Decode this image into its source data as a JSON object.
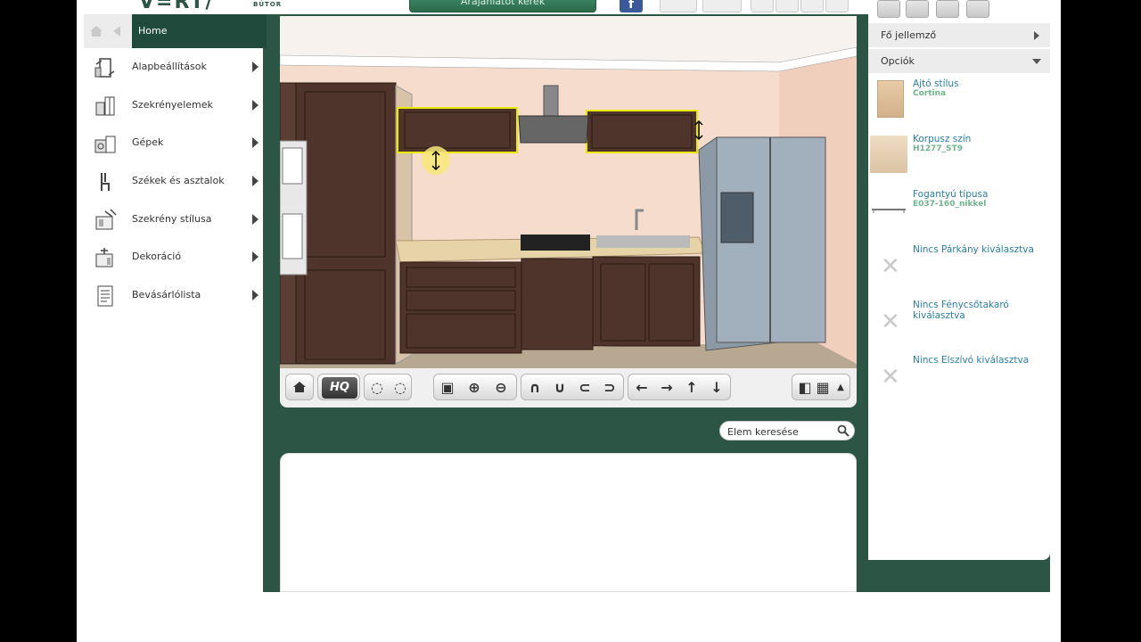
{
  "header": {
    "logo_text": "V=RT/",
    "logo_sub": "BÚTOR",
    "quote_button": "Árajánlatot kérek"
  },
  "sidebar": {
    "home_label": "Home",
    "items": [
      {
        "label": "Alapbeállítások",
        "icon": "settings-cabinet-icon"
      },
      {
        "label": "Szekrényelemek",
        "icon": "cabinet-elements-icon"
      },
      {
        "label": "Gépek",
        "icon": "appliances-icon"
      },
      {
        "label": "Székek és asztalok",
        "icon": "chair-table-icon"
      },
      {
        "label": "Szekrény stílusa",
        "icon": "cabinet-style-icon"
      },
      {
        "label": "Dekoráció",
        "icon": "decoration-icon"
      },
      {
        "label": "Bevásárlólista",
        "icon": "shopping-list-icon"
      }
    ]
  },
  "toolbar3d": {
    "hq_label": "HQ"
  },
  "search": {
    "placeholder": "Elem keresése"
  },
  "rightpanel": {
    "accordion": [
      {
        "label": "Fő jellemző",
        "expanded": false
      },
      {
        "label": "Opciók",
        "expanded": true
      }
    ],
    "options": [
      {
        "title": "Ajtó stílus",
        "value": "Cortina",
        "thumb": "door-style-thumb"
      },
      {
        "title": "Korpusz szín",
        "value": "H1277_ST9",
        "thumb": "body-color-thumb"
      },
      {
        "title": "Fogantyú típusa",
        "value": "E037-160_nikkel",
        "thumb": "handle-thumb"
      },
      {
        "title": "Nincs Párkány kiválasztva",
        "value": "",
        "thumb": "none-x-icon"
      },
      {
        "title": "Nincs Fénycsőtakaró kiválasztva",
        "value": "",
        "thumb": "none-x-icon"
      },
      {
        "title": "Nincs Elszívó kiválasztva",
        "value": "",
        "thumb": "none-x-icon"
      }
    ]
  },
  "colors": {
    "brand_green": "#2c5546",
    "link_blue": "#2a7fa0",
    "sub_green": "#6fb58c"
  }
}
